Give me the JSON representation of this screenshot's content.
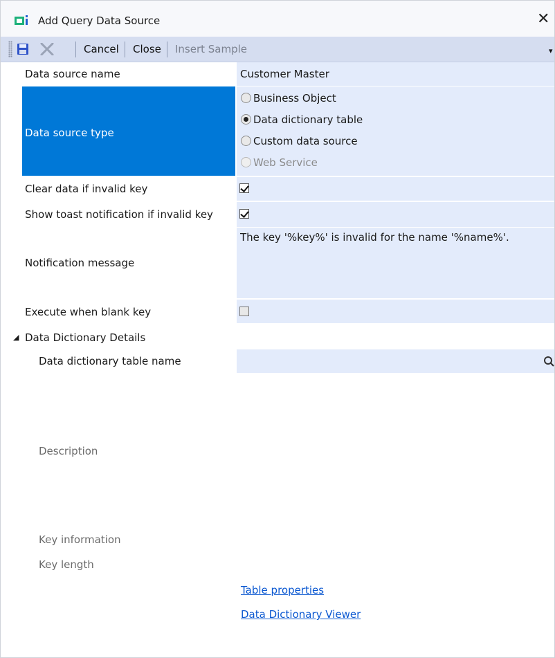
{
  "window": {
    "title": "Add Query Data Source",
    "close_glyph": "✕"
  },
  "toolbar": {
    "save_icon": "save-icon",
    "delete_icon": "delete-icon",
    "cancel_label": "Cancel",
    "close_label": "Close",
    "insert_sample_label": "Insert Sample",
    "overflow_glyph": "▾"
  },
  "properties": {
    "data_source_name": {
      "label": "Data source name",
      "value": "Customer Master"
    },
    "data_source_type": {
      "label": "Data source type",
      "options": [
        {
          "label": "Business Object",
          "selected": false,
          "enabled": true
        },
        {
          "label": "Data dictionary table",
          "selected": true,
          "enabled": true
        },
        {
          "label": "Custom data source",
          "selected": false,
          "enabled": true
        },
        {
          "label": "Web Service",
          "selected": false,
          "enabled": false
        }
      ]
    },
    "clear_data": {
      "label": "Clear data if invalid key",
      "checked": true
    },
    "show_toast": {
      "label": "Show toast notification if invalid key",
      "checked": true
    },
    "notification_message": {
      "label": "Notification message",
      "value": "The key '%key%' is invalid for the name '%name%'."
    },
    "execute_blank": {
      "label": "Execute when blank key",
      "checked": false
    }
  },
  "section": {
    "title": "Data Dictionary Details",
    "expanded_glyph": "◢",
    "table_name_label": "Data dictionary table name",
    "table_name_value": "",
    "search_icon": "search-icon",
    "description_label": "Description",
    "key_information_label": "Key information",
    "key_length_label": "Key length",
    "links": {
      "table_properties": "Table properties",
      "dd_viewer": "Data Dictionary Viewer"
    }
  },
  "colors": {
    "selection": "#0078d7",
    "value_cell": "#e3ebfb",
    "toolbar": "#d5ddf0",
    "link": "#0b58d1"
  }
}
